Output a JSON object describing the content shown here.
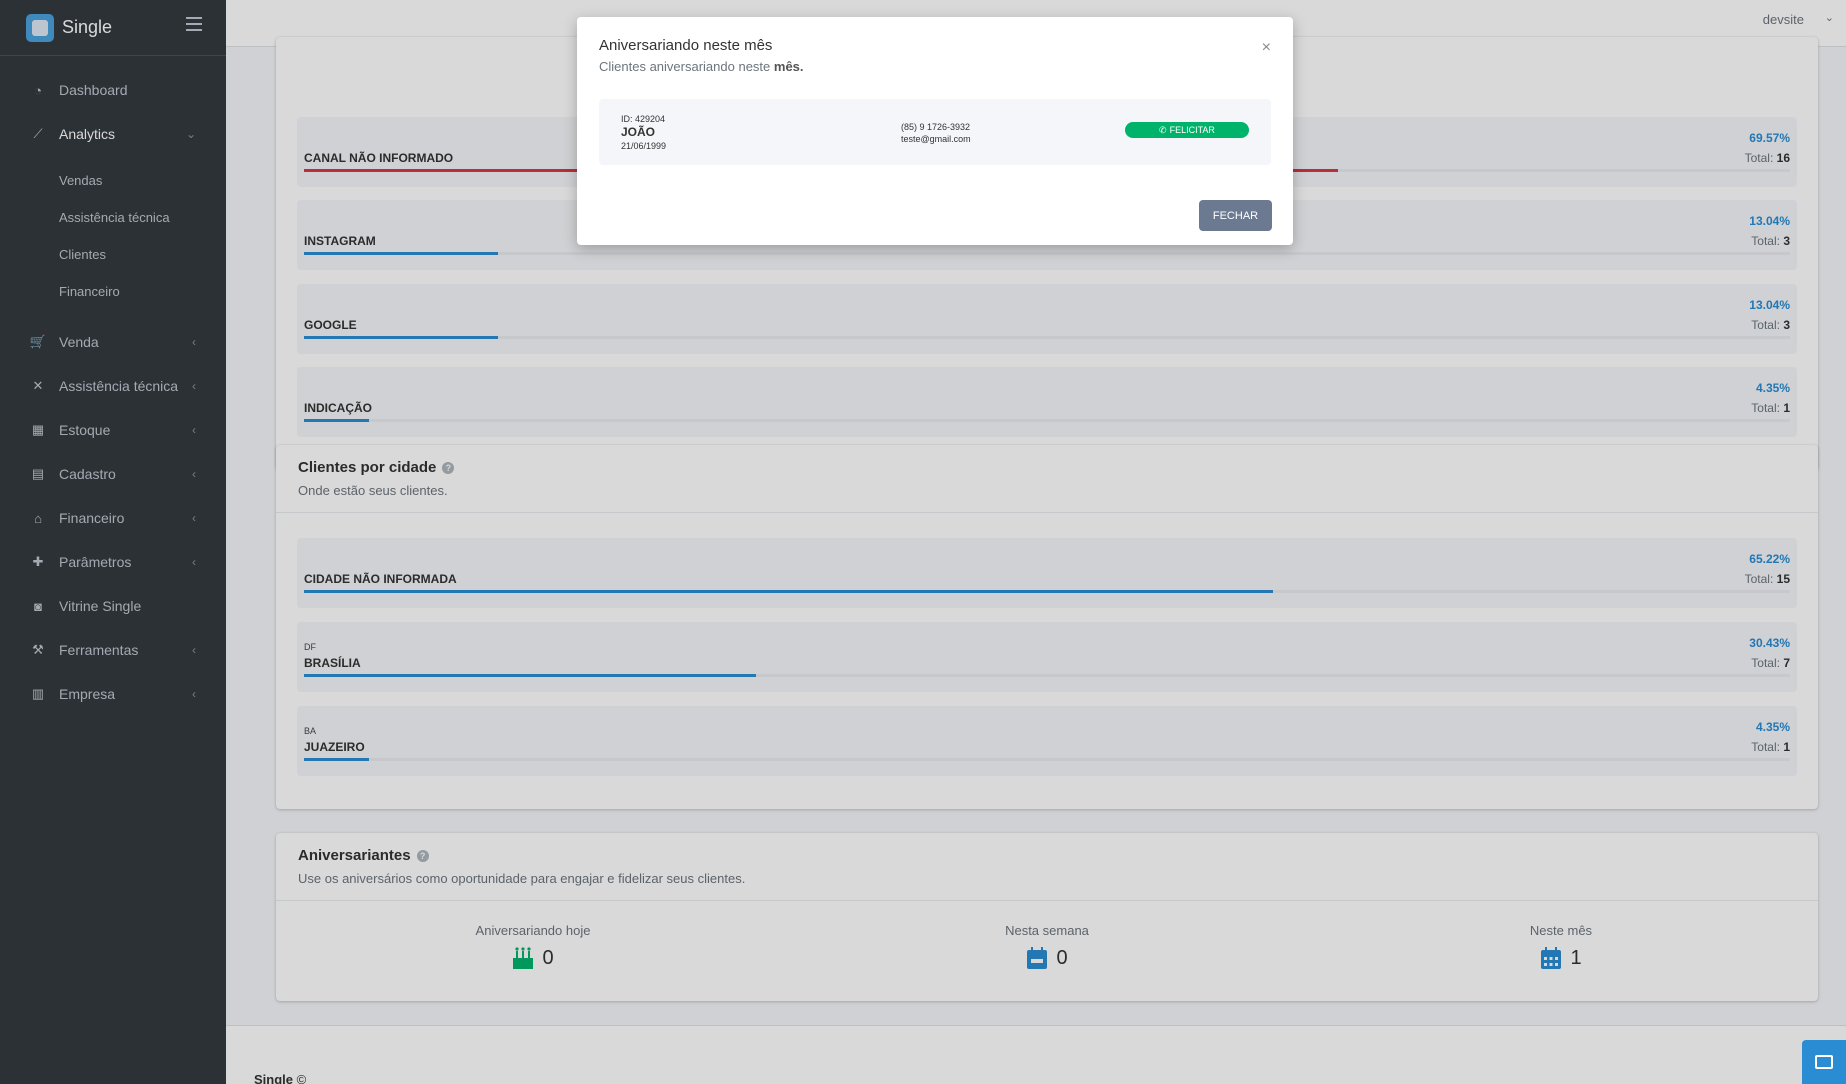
{
  "brand": {
    "name": "Single"
  },
  "topbar": {
    "user": "devsite"
  },
  "sidebar": {
    "items": [
      {
        "label": "Dashboard",
        "icon": "chart-pie-icon"
      },
      {
        "label": "Analytics",
        "icon": "chart-line-icon"
      },
      {
        "label": "Venda",
        "icon": "cart-icon"
      },
      {
        "label": "Assistência técnica",
        "icon": "tools-icon"
      },
      {
        "label": "Estoque",
        "icon": "boxes-icon"
      },
      {
        "label": "Cadastro",
        "icon": "id-card-icon"
      },
      {
        "label": "Financeiro",
        "icon": "bank-icon"
      },
      {
        "label": "Parâmetros",
        "icon": "puzzle-icon"
      },
      {
        "label": "Vitrine Single",
        "icon": "bag-icon"
      },
      {
        "label": "Ferramentas",
        "icon": "wrench-icon"
      },
      {
        "label": "Empresa",
        "icon": "building-icon"
      }
    ],
    "analytics_sub": [
      "Vendas",
      "Assistência técnica",
      "Clientes",
      "Financeiro"
    ]
  },
  "channels": {
    "total_label": "Total:",
    "rows": [
      {
        "name": "CANAL NÃO INFORMADO",
        "pct": "69.57%",
        "total": "16",
        "progress": 0.6957
      },
      {
        "name": "INSTAGRAM",
        "pct": "13.04%",
        "total": "3",
        "progress": 0.1304
      },
      {
        "name": "GOOGLE",
        "pct": "13.04%",
        "total": "3",
        "progress": 0.1304
      },
      {
        "name": "INDICAÇÃO",
        "pct": "4.35%",
        "total": "1",
        "progress": 0.0435
      }
    ]
  },
  "cities": {
    "title": "Clientes por cidade",
    "subtitle": "Onde estão seus clientes.",
    "total_label": "Total:",
    "rows": [
      {
        "state": "",
        "name": "CIDADE NÃO INFORMADA",
        "pct": "65.22%",
        "total": "15",
        "progress": 0.6522
      },
      {
        "state": "DF",
        "name": "BRASÍLIA",
        "pct": "30.43%",
        "total": "7",
        "progress": 0.3043
      },
      {
        "state": "BA",
        "name": "JUAZEIRO",
        "pct": "4.35%",
        "total": "1",
        "progress": 0.0435
      }
    ]
  },
  "birthdays": {
    "title": "Aniversariantes",
    "subtitle": "Use os aniversários como oportunidade para engajar e fidelizar seus clientes.",
    "today_label": "Aniversariando hoje",
    "today_value": "0",
    "week_label": "Nesta semana",
    "week_value": "0",
    "month_label": "Neste mês",
    "month_value": "1"
  },
  "footer": {
    "brand": "Single",
    "symbol": "©"
  },
  "modal": {
    "title": "Aniversariando neste mês",
    "subtitle_prefix": "Clientes aniversariando neste ",
    "subtitle_emph": "mês.",
    "close": "×",
    "client": {
      "id": "ID: 429204",
      "name": "JOÃO",
      "date": "21/06/1999",
      "phone": "(85) 9 1726-3932",
      "email": "teste@gmail.com"
    },
    "congrats_label": "FELICITAR",
    "close_button": "FECHAR"
  },
  "colors": {
    "sidebar_bg": "#343a40",
    "accent": "#2a8cd3",
    "danger": "#dc3545",
    "whatsapp": "#00b36b",
    "close_button": "#6c7a91"
  }
}
